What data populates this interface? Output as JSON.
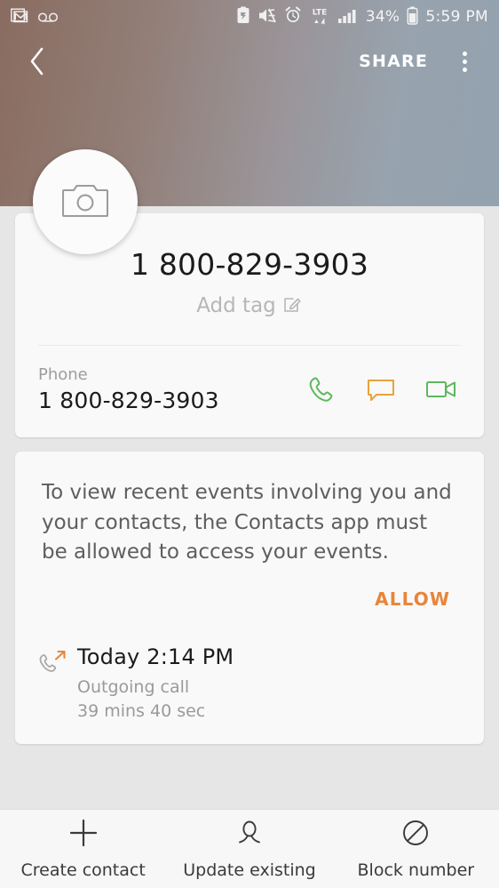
{
  "statusbar": {
    "left_icons": [
      "gmail-icon",
      "voicemail-icon"
    ],
    "right_icons": [
      "battery-saver-icon",
      "mute-icon",
      "alarm-icon",
      "lte-icon",
      "signal-icon",
      "battery-icon"
    ],
    "network": "LTE",
    "battery_percent": "34%",
    "time": "5:59 PM"
  },
  "navbar": {
    "back_icon": "chevron-left-icon",
    "share_label": "SHARE",
    "overflow_icon": "more-vertical-icon"
  },
  "avatar": {
    "icon": "camera-icon"
  },
  "contact": {
    "name": "1 800-829-3903",
    "add_tag_label": "Add tag",
    "add_tag_icon": "edit-icon",
    "phone_label": "Phone",
    "phone_value": "1 800-829-3903",
    "actions": [
      {
        "name": "call-action",
        "icon": "phone-icon",
        "color": "#5cb85c"
      },
      {
        "name": "message-action",
        "icon": "message-bubble-icon",
        "color": "#e8a33a"
      },
      {
        "name": "video-call-action",
        "icon": "video-camera-icon",
        "color": "#5cb85c"
      }
    ]
  },
  "permission": {
    "text": "To view recent events involving you and your contacts, the Contacts app must be allowed to access your events.",
    "allow_label": "ALLOW",
    "allow_color": "#e8853a"
  },
  "call_log": [
    {
      "icon": "outgoing-call-icon",
      "time": "Today 2:14 PM",
      "type": "Outgoing call",
      "duration": "39 mins 40 sec"
    }
  ],
  "bottombar": {
    "items": [
      {
        "name": "create-contact",
        "icon": "plus-icon",
        "label": "Create contact"
      },
      {
        "name": "update-existing",
        "icon": "person-icon",
        "label": "Update existing"
      },
      {
        "name": "block-number",
        "icon": "block-icon",
        "label": "Block number"
      }
    ]
  }
}
